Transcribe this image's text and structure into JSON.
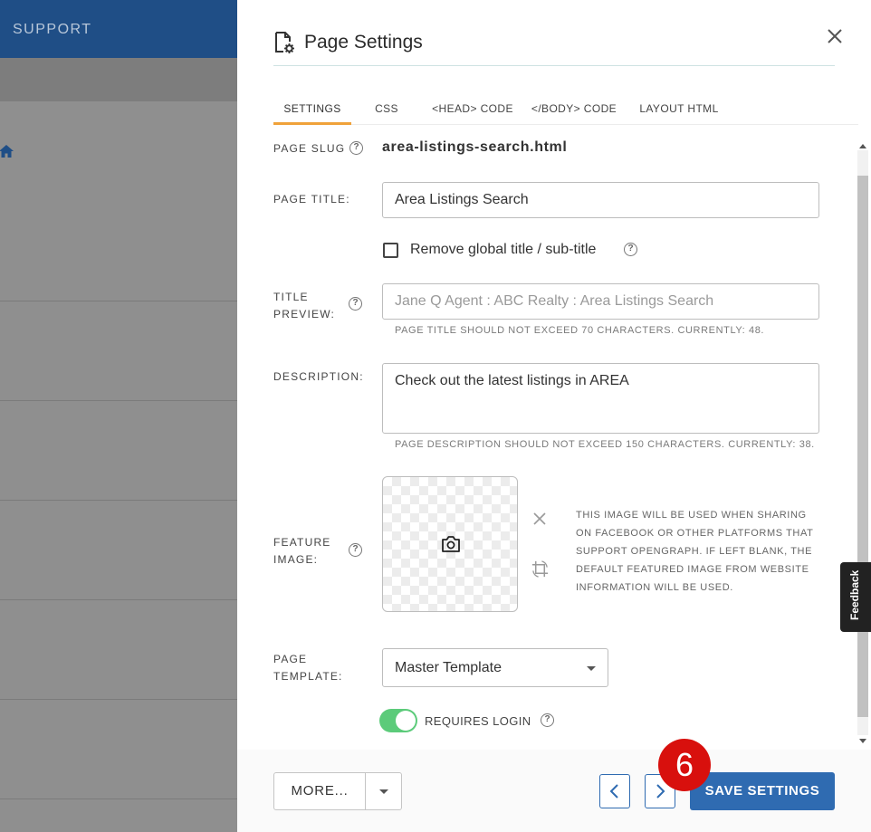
{
  "background": {
    "nav_label": "SUPPORT"
  },
  "panel": {
    "title": "Page Settings",
    "tabs": [
      {
        "label": "SETTINGS",
        "active": true
      },
      {
        "label": "CSS",
        "active": false
      },
      {
        "label": "<HEAD> CODE",
        "active": false
      },
      {
        "label": "</BODY> CODE",
        "active": false
      },
      {
        "label": "LAYOUT HTML",
        "active": false
      }
    ]
  },
  "form": {
    "page_slug": {
      "label": "PAGE SLUG",
      "value": "area-listings-search.html"
    },
    "page_title": {
      "label": "PAGE TITLE:",
      "value": "Area Listings Search"
    },
    "remove_global_title": {
      "label": "Remove global title / sub-title",
      "checked": false
    },
    "title_preview": {
      "label_line1": "TITLE",
      "label_line2": "PREVIEW:",
      "placeholder": "Jane Q Agent : ABC Realty : Area Listings Search",
      "hint": "PAGE TITLE SHOULD NOT EXCEED 70 CHARACTERS. CURRENTLY: 48."
    },
    "description": {
      "label": "DESCRIPTION:",
      "value": "Check out the latest listings in AREA",
      "hint": "PAGE DESCRIPTION SHOULD NOT EXCEED 150 CHARACTERS. CURRENTLY: 38."
    },
    "feature_image": {
      "label_line1": "FEATURE",
      "label_line2": "IMAGE:",
      "note": "THIS IMAGE WILL BE USED WHEN SHARING ON FACEBOOK OR OTHER PLATFORMS THAT SUPPORT OPENGRAPH. IF LEFT BLANK, THE DEFAULT FEATURED IMAGE FROM WEBSITE INFORMATION WILL BE USED."
    },
    "page_template": {
      "label_line1": "PAGE",
      "label_line2": "TEMPLATE:",
      "value": "Master Template"
    },
    "requires_login": {
      "label": "REQUIRES LOGIN",
      "on": true
    }
  },
  "footer": {
    "more_label": "MORE...",
    "save_label": "SAVE SETTINGS"
  },
  "step_badge": "6",
  "feedback_label": "Feedback",
  "colors": {
    "header_blue": "#1f4e86",
    "primary_blue": "#2f6bb1",
    "active_tab_underline": "#f0a23a",
    "toggle_on": "#5ccb7a",
    "step_badge_red": "#d8100d"
  }
}
